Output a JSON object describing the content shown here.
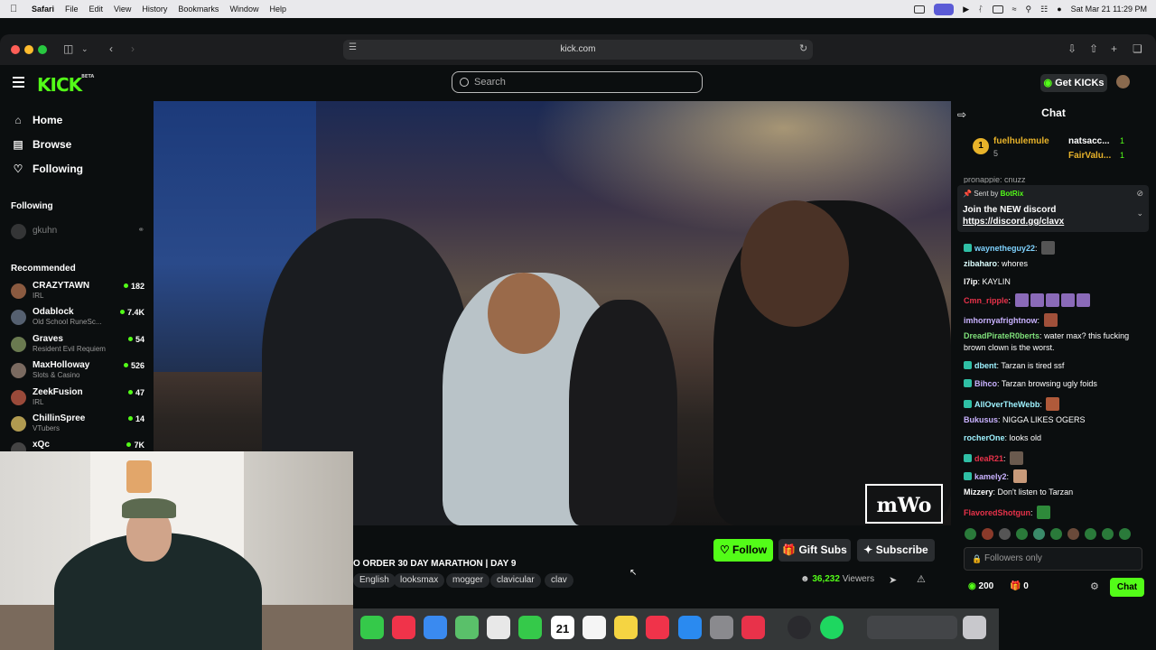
{
  "menubar": {
    "app": "Safari",
    "items": [
      "File",
      "Edit",
      "View",
      "History",
      "Bookmarks",
      "Window",
      "Help"
    ],
    "clock": "Sat Mar 21  11:29 PM"
  },
  "browser": {
    "url": "kick.com"
  },
  "header": {
    "logo": "KICK",
    "logo_beta": "BETA",
    "search_placeholder": "Search",
    "get_kicks": "Get KICKs"
  },
  "sidebar": {
    "nav": [
      {
        "label": "Home",
        "icon": "home-icon"
      },
      {
        "label": "Browse",
        "icon": "browse-icon"
      },
      {
        "label": "Following",
        "icon": "heart-icon"
      }
    ],
    "following_title": "Following",
    "following_user": "gkuhn",
    "recommended_title": "Recommended",
    "recommended": [
      {
        "name": "CRAZYTAWN",
        "category": "IRL",
        "viewers": "182"
      },
      {
        "name": "Odablock",
        "category": "Old School RuneSc...",
        "viewers": "7.4K"
      },
      {
        "name": "Graves",
        "category": "Resident Evil Requiem",
        "viewers": "54"
      },
      {
        "name": "MaxHolloway",
        "category": "Slots & Casino",
        "viewers": "526"
      },
      {
        "name": "ZeekFusion",
        "category": "IRL",
        "viewers": "47"
      },
      {
        "name": "ChillinSpree",
        "category": "VTubers",
        "viewers": "14"
      },
      {
        "name": "xQc",
        "category": "",
        "viewers": "7K"
      }
    ]
  },
  "stream": {
    "title": "O ORDER 30 DAY MARATHON | DAY 9",
    "tags": [
      "English",
      "looksmax",
      "mogger",
      "clavicular",
      "clav"
    ],
    "follow_label": "Follow",
    "gift_label": "Gift Subs",
    "subscribe_label": "Subscribe",
    "viewers": "36,232",
    "viewers_label": "Viewers",
    "watermark": "mWo"
  },
  "chat": {
    "title": "Chat",
    "gifters": [
      {
        "name": "fuelhulemule",
        "rank": "1",
        "count": "5"
      },
      {
        "name": "natsacc...",
        "count": "1"
      },
      {
        "name": "FairValu...",
        "count": "1"
      }
    ],
    "truncated_msg": "pronappie: cnuzz",
    "pinned": {
      "sent_by": "Sent by",
      "bot": "BotRix",
      "text": "Join the NEW discord",
      "link": "https://discord.gg/clavx"
    },
    "messages": [
      {
        "user": "waynetheguy22",
        "text": "",
        "color": "#7fd3ff",
        "emote": true
      },
      {
        "user": "zibaharo",
        "text": "whores",
        "color": "#ffffff",
        "emote": false
      },
      {
        "user": "l7ip",
        "text": "KAYLIN",
        "color": "#ffffff",
        "emote": false
      },
      {
        "user": "Cmn_ripple",
        "text": "",
        "color": "#e8324a",
        "emote": true
      },
      {
        "user": "imhornyafrightnow",
        "text": "",
        "color": "#c9b2ff",
        "emote": true
      },
      {
        "user": "DreadPirateR0berts",
        "text": "water max? this fucking",
        "color": "#7fe07a",
        "emote": false
      },
      {
        "user": "",
        "text": "brown clown is the worst.",
        "color": "#ffffff",
        "emote": false
      },
      {
        "user": "dbent",
        "text": "Tarzan is tired ssf",
        "color": "#9ef2ff",
        "emote": false
      },
      {
        "user": "Bihco",
        "text": "Tarzan browsing ugly foids",
        "color": "#c9b2ff",
        "emote": false
      },
      {
        "user": "AllOverTheWebb",
        "text": "",
        "color": "#9ef2ff",
        "emote": true
      },
      {
        "user": "Bukusus",
        "text": "NIGGA LIKES OGERS",
        "color": "#c9b2ff",
        "emote": false
      },
      {
        "user": "rocherOne",
        "text": "looks old",
        "color": "#9ef2ff",
        "emote": false
      },
      {
        "user": "deaR21",
        "text": "",
        "color": "#e8324a",
        "emote": true
      },
      {
        "user": "kamely2",
        "text": "",
        "color": "#c9b2ff",
        "emote": true
      },
      {
        "user": "Mizzery",
        "text": "Don't listen to Tarzan",
        "color": "#ffffff",
        "emote": false
      },
      {
        "user": "FlavoredShotgun",
        "text": "",
        "color": "#e8324a",
        "emote": true
      }
    ],
    "input_placeholder": "Followers only",
    "kicks_count": "200",
    "gift_count": "0",
    "send_label": "Chat"
  },
  "dock": {
    "calendar_day": "21"
  }
}
